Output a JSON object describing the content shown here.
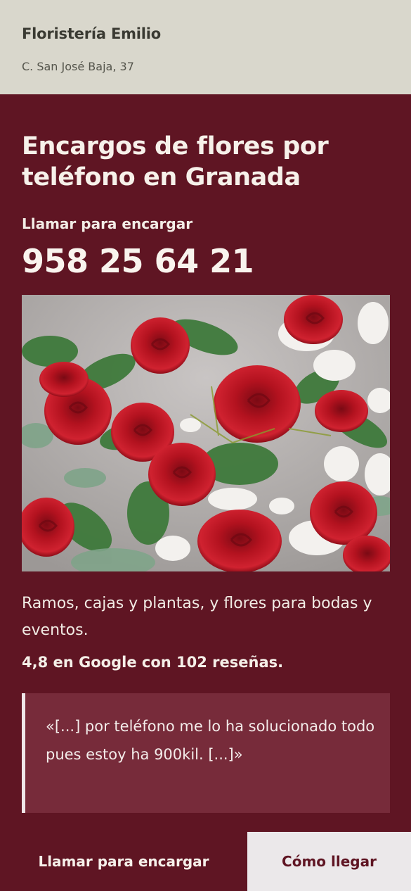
{
  "header": {
    "business_name": "Floristería Emilio",
    "address": "C. San José Baja, 37"
  },
  "main": {
    "headline": "Encargos de flores por teléfono en Granada",
    "call_label": "Llamar para encargar",
    "phone": "958 25 64 21",
    "photo_alt": "red-roses-bouquet",
    "description": "Ramos, cajas y plantas, y flores para bodas y eventos.",
    "rating": "4,8 en Google con 102 reseñas.",
    "quote": "«[...] por teléfono me lo ha solucionado todo pues estoy ha 900kil. [...]»"
  },
  "bottom_bar": {
    "call_button": "Llamar para encargar",
    "directions_button": "Cómo llegar"
  },
  "colors": {
    "brand": "#5f1523",
    "header_bg": "#d9d7cc",
    "quote_bg": "#772b3a",
    "secondary_button_bg": "#ebe8ea"
  }
}
